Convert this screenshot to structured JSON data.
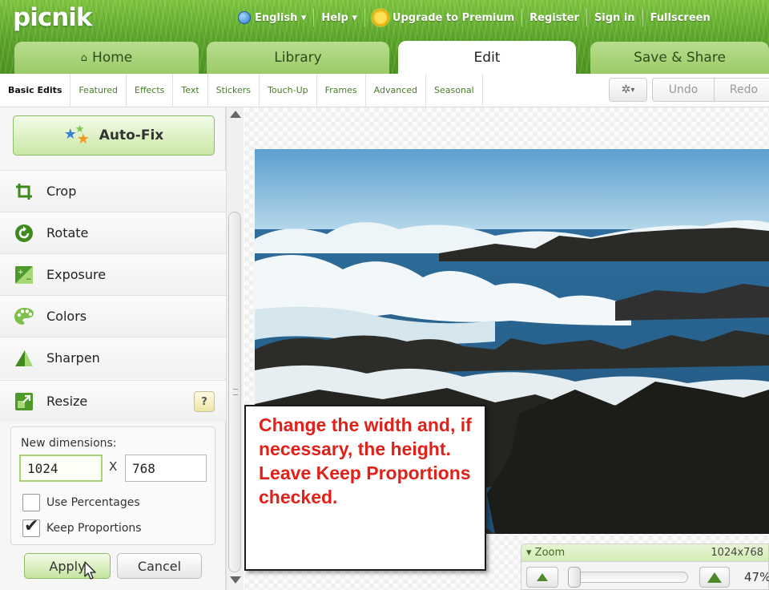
{
  "app": {
    "logo": "picnik"
  },
  "topnav": {
    "language": "English ▾",
    "help": "Help ▾",
    "upgrade": "Upgrade to Premium",
    "register": "Register",
    "sign_in": "Sign in",
    "fullscreen": "Fullscreen"
  },
  "tabs": [
    {
      "label": "Home",
      "active": false
    },
    {
      "label": "Library",
      "active": false
    },
    {
      "label": "Edit",
      "active": true
    },
    {
      "label": "Save & Share",
      "active": false
    }
  ],
  "subnav": {
    "items": [
      "Basic Edits",
      "Featured",
      "Effects",
      "Text",
      "Stickers",
      "Touch-Up",
      "Frames",
      "Advanced",
      "Seasonal"
    ],
    "active": "Basic Edits",
    "undo": "Undo",
    "redo": "Redo"
  },
  "left_panel": {
    "autofix": "Auto-Fix",
    "tools": [
      "Crop",
      "Rotate",
      "Exposure",
      "Colors",
      "Sharpen",
      "Resize"
    ],
    "help_badge": "?",
    "resize": {
      "label": "New dimensions:",
      "width": "1024",
      "separator": "X",
      "height": "768",
      "use_percentages": "Use Percentages",
      "use_percentages_checked": false,
      "keep_proportions": "Keep Proportions",
      "keep_proportions_checked": true
    },
    "apply": "Apply",
    "cancel": "Cancel"
  },
  "callout": {
    "text": "Change the width and, if necessary, the height. Leave Keep Proportions checked.",
    "color": "#e0211a"
  },
  "zoom": {
    "label": "Zoom",
    "dimensions": "1024x768",
    "percent": "47%",
    "level": 0.47
  },
  "colors": {
    "brand_green": "#5aa42a",
    "tab_green": "#b9dd8e",
    "link_green": "#4a7c2b"
  }
}
